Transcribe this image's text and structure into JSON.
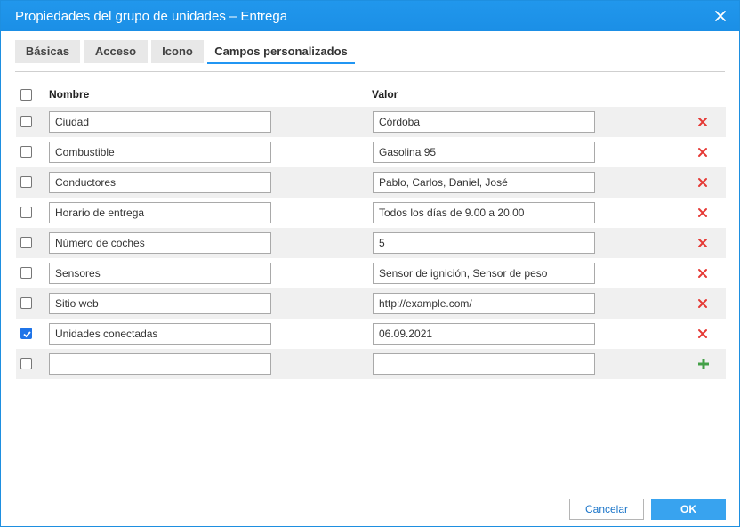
{
  "dialog": {
    "title": "Propiedades del grupo de unidades – Entrega",
    "accent_color": "#1e90ff"
  },
  "tabs": [
    {
      "label": "Básicas",
      "active": false
    },
    {
      "label": "Acceso",
      "active": false
    },
    {
      "label": "Icono",
      "active": false
    },
    {
      "label": "Campos personalizados",
      "active": true
    }
  ],
  "table": {
    "header_name": "Nombre",
    "header_value": "Valor",
    "rows": [
      {
        "name": "Ciudad",
        "value": "Córdoba",
        "checked": false
      },
      {
        "name": "Combustible",
        "value": "Gasolina 95",
        "checked": false
      },
      {
        "name": "Conductores",
        "value": "Pablo, Carlos, Daniel, José",
        "checked": false
      },
      {
        "name": "Horario de entrega",
        "value": "Todos los días de 9.00 a 20.00",
        "checked": false
      },
      {
        "name": "Número de coches",
        "value": "5",
        "checked": false
      },
      {
        "name": "Sensores",
        "value": "Sensor de ignición, Sensor de peso",
        "checked": false
      },
      {
        "name": "Sitio web",
        "value": "http://example.com/",
        "checked": false
      },
      {
        "name": "Unidades conectadas",
        "value": "06.09.2021",
        "checked": true
      }
    ],
    "new_row": {
      "name": "",
      "value": ""
    },
    "delete_icon": "x-icon",
    "delete_color": "#e53935",
    "add_icon": "plus-icon",
    "add_color": "#43a047"
  },
  "buttons": {
    "cancel_label": "Cancelar",
    "ok_label": "OK"
  }
}
